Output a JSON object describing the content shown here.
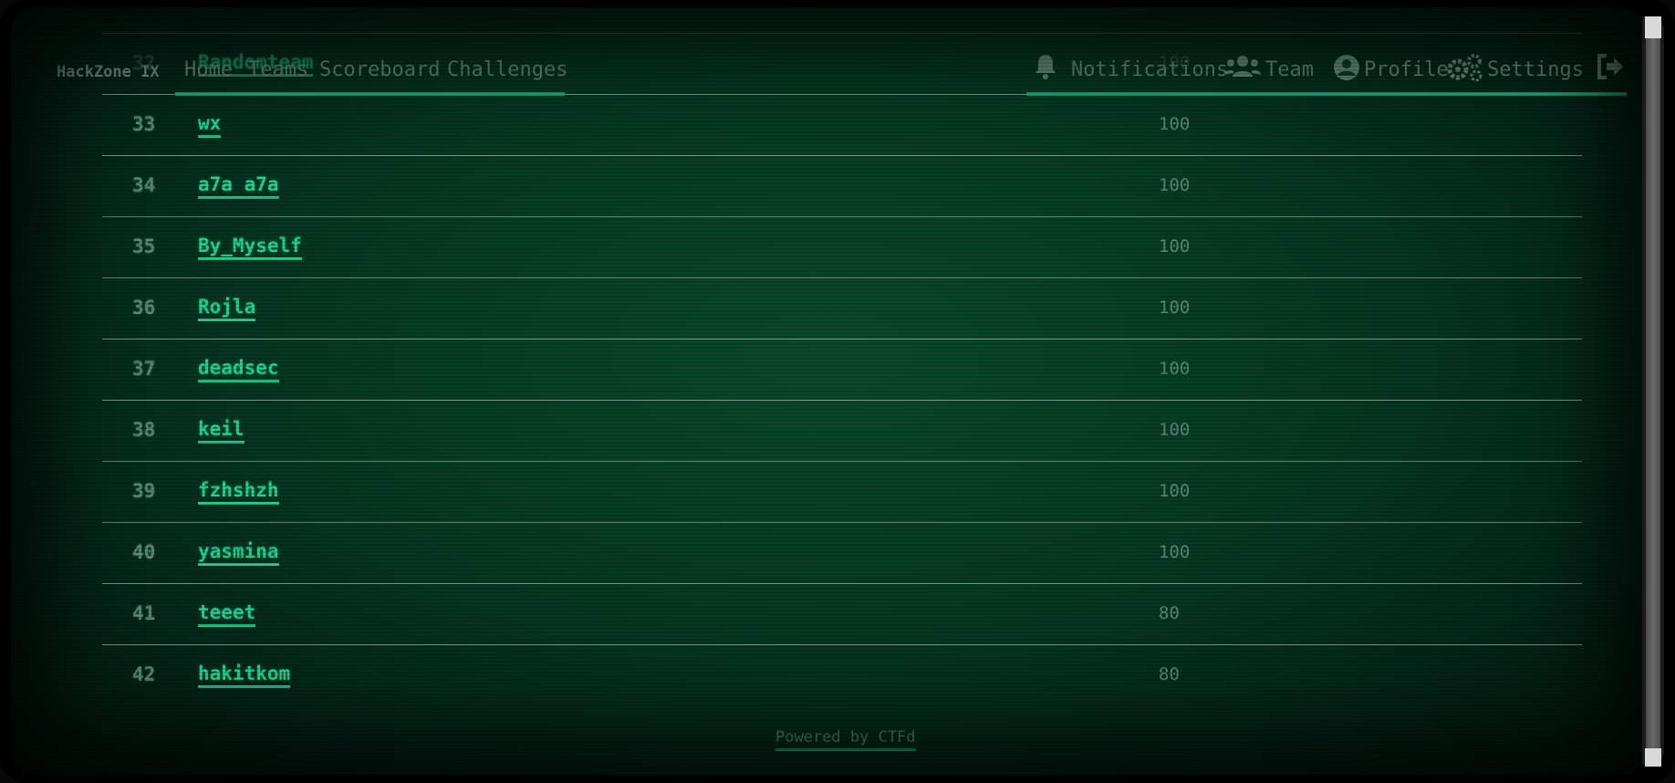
{
  "brand": "HackZone IX",
  "nav_left": [
    {
      "label": "Home"
    },
    {
      "label": "Teams"
    },
    {
      "label": "Scoreboard"
    },
    {
      "label": "Challenges"
    }
  ],
  "nav_right": [
    {
      "label": "Notifications",
      "icon": "bell-icon"
    },
    {
      "label": "Team",
      "icon": "users-icon"
    },
    {
      "label": "Profile",
      "icon": "user-circle-icon"
    },
    {
      "label": "Settings",
      "icon": "gears-icon"
    },
    {
      "label": "",
      "icon": "logout-icon"
    }
  ],
  "rows": [
    {
      "rank": "32",
      "team": "Randomteam",
      "score": "100"
    },
    {
      "rank": "33",
      "team": "wx",
      "score": "100"
    },
    {
      "rank": "34",
      "team": "a7a a7a",
      "score": "100"
    },
    {
      "rank": "35",
      "team": "By_Myself",
      "score": "100"
    },
    {
      "rank": "36",
      "team": "Rojla",
      "score": "100"
    },
    {
      "rank": "37",
      "team": "deadsec",
      "score": "100"
    },
    {
      "rank": "38",
      "team": "keil",
      "score": "100"
    },
    {
      "rank": "39",
      "team": "fzhshzh",
      "score": "100"
    },
    {
      "rank": "40",
      "team": "yasmina",
      "score": "100"
    },
    {
      "rank": "41",
      "team": "teeet",
      "score": "80"
    },
    {
      "rank": "42",
      "team": "hakitkom",
      "score": "80"
    }
  ],
  "footer": "Powered by CTFd",
  "colors": {
    "accent": "#1ecc90",
    "muted": "#5c8a78",
    "background": "#063a22"
  }
}
